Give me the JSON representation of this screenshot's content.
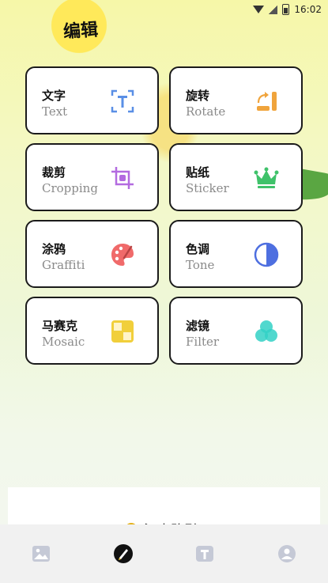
{
  "app": {
    "title_main": "",
    "title_sub": "编辑"
  },
  "status_bar": {
    "time": "16:02",
    "battery_level_fraction": 0.8
  },
  "tools": [
    {
      "cn": "文字",
      "en": "Text",
      "icon": "text-icon",
      "color": "#5a8fe6"
    },
    {
      "cn": "旋转",
      "en": "Rotate",
      "icon": "rotate-icon",
      "color": "#f0a43c"
    },
    {
      "cn": "裁剪",
      "en": "Cropping",
      "icon": "crop-icon",
      "color": "#b36be0"
    },
    {
      "cn": "贴纸",
      "en": "Sticker",
      "icon": "crown-icon",
      "color": "#3fc26a"
    },
    {
      "cn": "涂鸦",
      "en": "Graffiti",
      "icon": "palette-icon",
      "color": "#f06a6a"
    },
    {
      "cn": "色调",
      "en": "Tone",
      "icon": "tone-icon",
      "color": "#4e6fe0"
    },
    {
      "cn": "马赛克",
      "en": "Mosaic",
      "icon": "mosaic-icon",
      "color": "#f1cf3b"
    },
    {
      "cn": "滤镜",
      "en": "Filter",
      "icon": "filter-icon",
      "color": "#33d1c5"
    }
  ],
  "bottom_panel": {
    "text": "江山路引"
  },
  "tabbar": {
    "items": [
      {
        "name": "gallery-tab",
        "icon": "image-icon",
        "active": false
      },
      {
        "name": "edit-tab",
        "icon": "brush-icon",
        "active": true
      },
      {
        "name": "text-tab",
        "icon": "text-box-icon",
        "active": false
      },
      {
        "name": "profile-tab",
        "icon": "person-icon",
        "active": false
      }
    ]
  }
}
